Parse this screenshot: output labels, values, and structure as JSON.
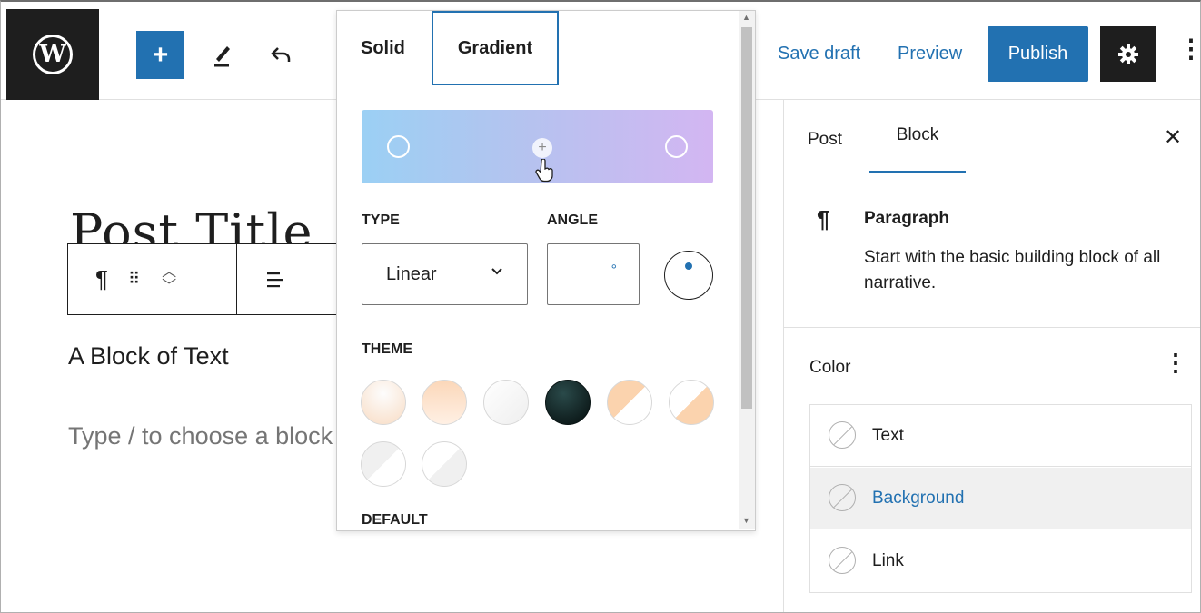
{
  "header": {
    "add_label": "+",
    "save_draft": "Save draft",
    "preview": "Preview",
    "publish": "Publish"
  },
  "editor": {
    "post_title": "Post Title",
    "text_block": "A Block of Text",
    "placeholder": "Type / to choose a block"
  },
  "popover": {
    "tabs": [
      "Solid",
      "Gradient"
    ],
    "active_tab": "Gradient",
    "gradient": {
      "from": "#9bd0f4",
      "to": "#d3b6f2"
    },
    "type_label": "TYPE",
    "type_value": "Linear",
    "angle_label": "ANGLE",
    "angle_unit": "°",
    "theme_label": "THEME",
    "default_label": "DEFAULT"
  },
  "sidebar": {
    "tabs": [
      "Post",
      "Block"
    ],
    "active_tab": "Block",
    "block_title": "Paragraph",
    "block_desc": "Start with the basic building block of all narrative.",
    "color_title": "Color",
    "color_items": [
      "Text",
      "Background",
      "Link"
    ],
    "selected_color_item": "Background"
  },
  "colors": {
    "accent": "#2271b1",
    "dark": "#1e1e1e"
  }
}
